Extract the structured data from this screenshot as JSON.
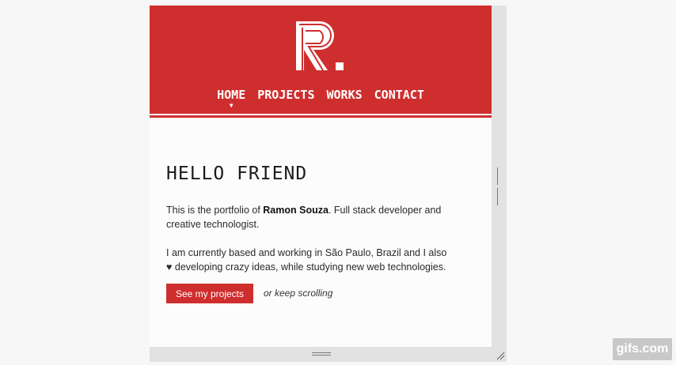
{
  "nav": {
    "items": [
      {
        "label": "HOME",
        "active": true
      },
      {
        "label": "PROJECTS",
        "active": false
      },
      {
        "label": "WORKS",
        "active": false
      },
      {
        "label": "CONTACT",
        "active": false
      }
    ]
  },
  "hero": {
    "heading": "HELLO FRIEND",
    "intro_prefix": "This is the portfolio of ",
    "name": "Ramon Souza",
    "intro_suffix": ". Full stack developer and creative technologist.",
    "paragraph2": "I am currently based and working in São Paulo, Brazil and I also ♥ developing crazy ideas, while studying new web technologies.",
    "cta_label": "See my projects",
    "cta_alt": "or keep scrolling"
  },
  "watermark": "gifs.com",
  "colors": {
    "accent": "#cf2e2e",
    "background": "#fcfcfc",
    "text": "#2a2a2a"
  },
  "icons": {
    "logo": "r-monogram-logo",
    "nav_active": "chevron-down-icon",
    "resize": "resize-grip-icon"
  }
}
